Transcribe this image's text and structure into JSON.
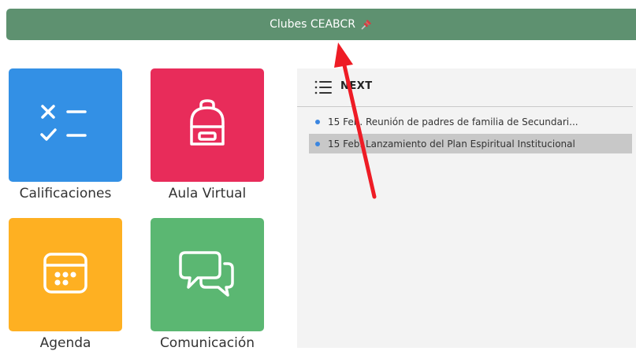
{
  "banner": {
    "title": "Clubes CEABCR"
  },
  "tiles": [
    {
      "label": "Calificaciones",
      "color": "#3390e5",
      "icon": "grading-checklist-icon"
    },
    {
      "label": "Aula Virtual",
      "color": "#e82c5a",
      "icon": "backpack-icon"
    },
    {
      "label": "Agenda",
      "color": "#feb022",
      "icon": "calendar-icon"
    },
    {
      "label": "Comunicación",
      "color": "#5bb772",
      "icon": "chat-bubbles-icon"
    }
  ],
  "events_panel": {
    "title": "NEXT",
    "events": [
      {
        "date": "15 Feb.",
        "description": "Reunión de padres de familia de Secundari..."
      },
      {
        "date": "15 Feb.",
        "description": "Lanzamiento del Plan Espiritual Institucional"
      }
    ]
  },
  "colors": {
    "banner": "#5e9170",
    "event_dot": "#3b86e0",
    "annotation_arrow": "#ee1c25"
  }
}
